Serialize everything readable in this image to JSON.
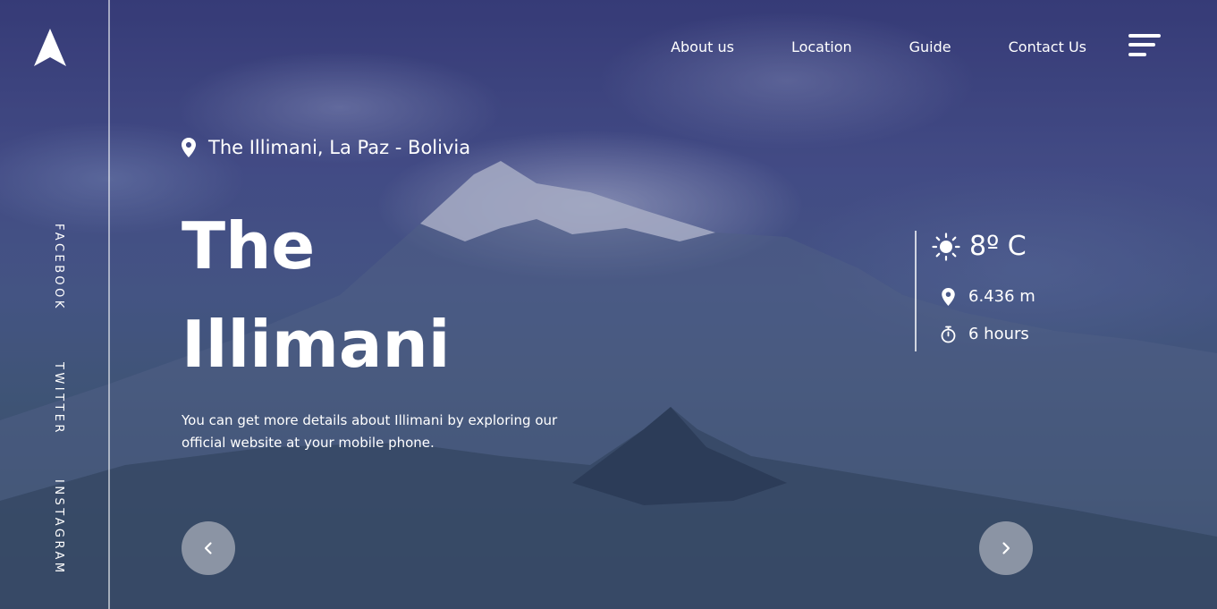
{
  "brand": {
    "logo_icon": "arrow-up-icon"
  },
  "social": {
    "facebook": "FACEBOOK",
    "twitter": "TWITTER",
    "instagram": "INSTAGRAM"
  },
  "nav": {
    "items": [
      "About us",
      "Location",
      "Guide",
      "Contact Us"
    ],
    "menu_icon": "hamburger-menu-icon"
  },
  "hero": {
    "location": "The Illimani, La Paz - Bolivia",
    "title_line1": "The",
    "title_line2": "Illimani",
    "description": "You can get more details about Illimani by exploring our official website at your mobile phone."
  },
  "stats": {
    "temperature": "8º C",
    "altitude": "6.436 m",
    "duration": "6 hours"
  },
  "controls": {
    "prev_icon": "chevron-left-icon",
    "next_icon": "chevron-right-icon"
  },
  "colors": {
    "text": "#ffffff",
    "overlay": "#2d2f6e",
    "button_bg": "#d2d2d7"
  }
}
